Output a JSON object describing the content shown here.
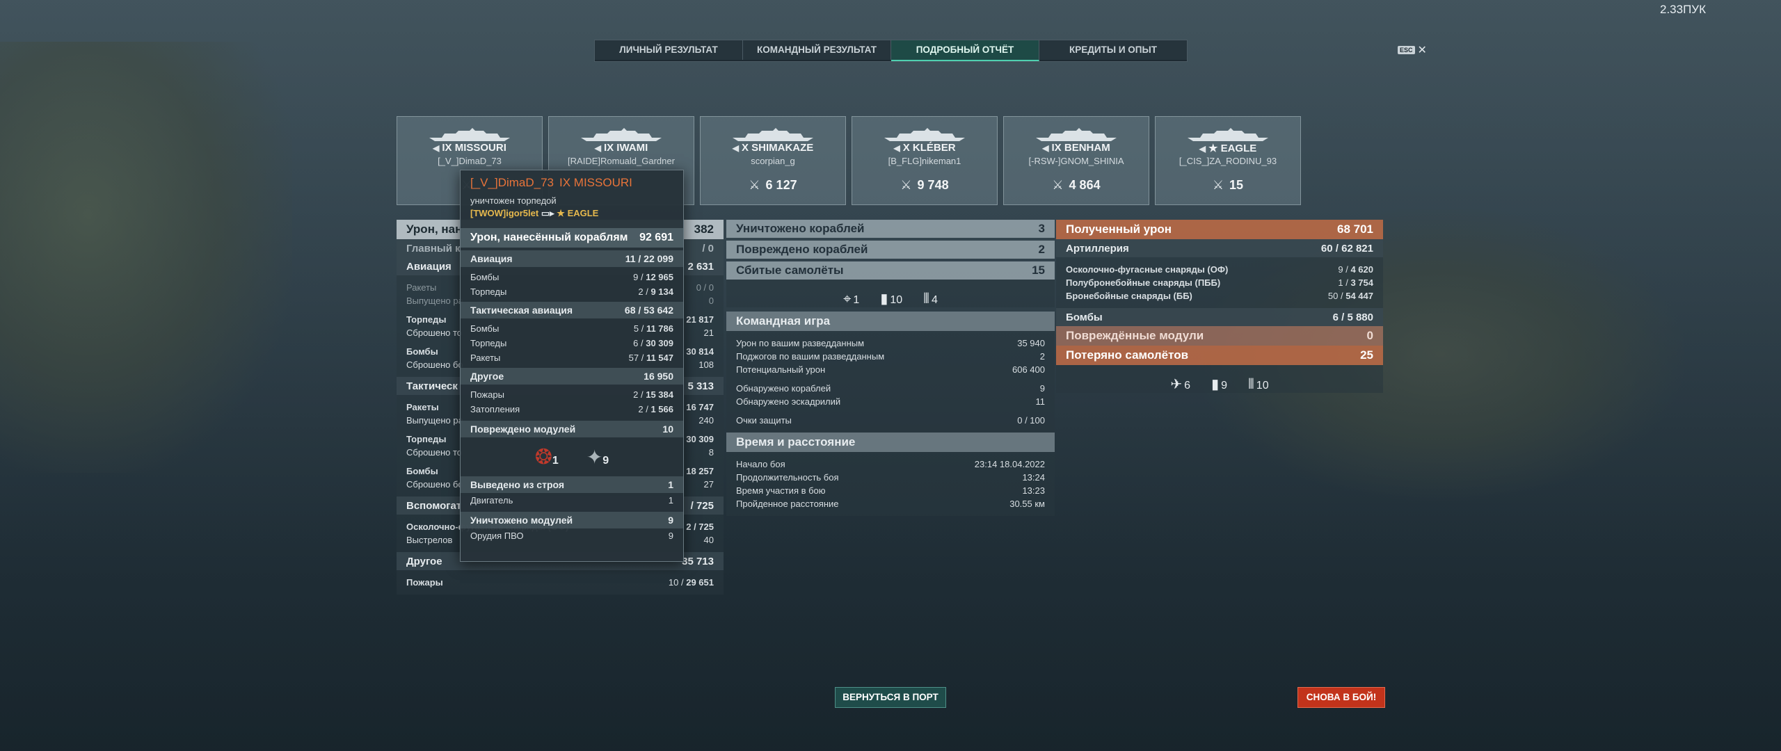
{
  "clock": "2.33ПУК",
  "tabs": [
    "ЛИЧНЫЙ РЕЗУЛЬТАТ",
    "КОМАНДНЫЙ РЕЗУЛЬТАТ",
    "ПОДРОБНЫЙ ОТЧЁТ",
    "КРЕДИТЫ И ОПЫТ"
  ],
  "esc_key": "ESC",
  "esc_close": "✕",
  "cards": [
    {
      "tier": "IX",
      "ship": "MISSOURI",
      "player": "[_V_]DimaD_73",
      "v1": "",
      "v2": ""
    },
    {
      "tier": "IX",
      "ship": "IWAMI",
      "player": "[RAIDE]Romuald_Gardner",
      "v1": "",
      "v2": ""
    },
    {
      "tier": "X",
      "ship": "SHIMAKAZE",
      "player": "scorpian_g",
      "v1": "",
      "v2": "6 127"
    },
    {
      "tier": "X",
      "ship": "KLÉBER",
      "player": "[B_FLG]nikeman1",
      "v1": "",
      "v2": "9 748"
    },
    {
      "tier": "IX",
      "ship": "BENHAM",
      "player": "[-RSW-]GNOM_SHINIA",
      "v1": "",
      "v2": "4 864"
    },
    {
      "tier": "★",
      "ship": "EAGLE",
      "player": "[_CIS_]ZA_RODINU_93",
      "v1": "",
      "v2": "15"
    }
  ],
  "left": {
    "dmg_label": "Урон, нан",
    "dmg_val": "382",
    "main_label": "Главный к",
    "main_val": "/ 0",
    "aviation_label": "Авиация",
    "aviation_val": "2 631",
    "rockets_label": "Ракеты",
    "rockets_val": "0 / 0",
    "rockets_sub": "Выпущено ра",
    "rockets_sub_val": "0",
    "torps_label": "Торпеды",
    "torps_val": "21 817",
    "torps_sub": "Сброшено то",
    "torps_sub_val": "21",
    "bombs_label": "Бомбы",
    "bombs_val": "30 814",
    "bombs_sub": "Сброшено бо",
    "bombs_sub_val": "108",
    "tact_label": "Тактическ",
    "tact_val": "5 313",
    "trockets_label": "Ракеты",
    "trockets_val": "16 747",
    "trockets_sub": "Выпущено ра",
    "trockets_sub_val": "240",
    "ttorps_label": "Торпеды",
    "ttorps_val": "30 309",
    "ttorps_sub": "Сброшено то",
    "ttorps_sub_val": "8",
    "tbombs_label": "Бомбы",
    "tbombs_val": "18 257",
    "tbombs_sub": "Сброшено бо",
    "tbombs_sub_val": "27",
    "sec_label": "Вспомогат",
    "sec_val": "/ 725",
    "he_label": "Осколочно-фугасные снаряды (ОФ)",
    "he_val": "2 / 725",
    "shots_label": "Выстрелов",
    "shots_val": "40",
    "other_label": "Другое",
    "other_val": "35 713",
    "fires_label": "Пожары",
    "fires_a": "10",
    "fires_b": "29 651"
  },
  "mid": {
    "destroyed_label": "Уничтожено кораблей",
    "destroyed_val": "3",
    "damaged_label": "Повреждено кораблей",
    "damaged_val": "2",
    "planes_label": "Сбитые самолёты",
    "planes_val": "15",
    "ic1": "1",
    "ic2": "10",
    "ic3": "4",
    "team_label": "Командная игра",
    "spot_dmg_label": "Урон по вашим разведданным",
    "spot_dmg_val": "35 940",
    "spot_fire_label": "Поджогов по вашим разведданным",
    "spot_fire_val": "2",
    "pot_label": "Потенциальный урон",
    "pot_val": "606 400",
    "det_ships_label": "Обнаружено кораблей",
    "det_ships_val": "9",
    "det_sq_label": "Обнаружено эскадрилий",
    "det_sq_val": "11",
    "def_label": "Очки защиты",
    "def_val": "0 / 100",
    "time_label": "Время и расстояние",
    "start_label": "Начало боя",
    "start_val": "23:14  18.04.2022",
    "dur_label": "Продолжительность боя",
    "dur_val": "13:24",
    "part_label": "Время участия в бою",
    "part_val": "13:23",
    "dist_label": "Пройденное расстояние",
    "dist_val": "30.55 км"
  },
  "right": {
    "recv_label": "Полученный урон",
    "recv_val": "68 701",
    "art_label": "Артиллерия",
    "art_a": "60",
    "art_b": "62 821",
    "he_label": "Осколочно-фугасные снаряды (ОФ)",
    "he_a": "9",
    "he_b": "4 620",
    "sap_label": "Полубронебойные снаряды (ПББ)",
    "sap_a": "1",
    "sap_b": "3 754",
    "ap_label": "Бронебойные снаряды (ББ)",
    "ap_a": "50",
    "ap_b": "54 447",
    "bombs_label": "Бомбы",
    "bombs_a": "6",
    "bombs_b": "5 880",
    "mods_label": "Повреждённые модули",
    "mods_val": "0",
    "lost_label": "Потеряно самолётов",
    "lost_val": "25",
    "ic1": "6",
    "ic2": "9",
    "ic3": "10"
  },
  "tooltip": {
    "player": "[_V_]DimaD_73",
    "ship": "IX MISSOURI",
    "status": "уничтожен торпедой",
    "killer": "[TWOW]igor5let",
    "killer_ship": "EAGLE",
    "dmg_label": "Урон, нанесённый кораблям",
    "dmg_val": "92 691",
    "av_label": "Авиация",
    "av_a": "11",
    "av_b": "22 099",
    "bombs_label": "Бомбы",
    "bombs_a": "9",
    "bombs_b": "12 965",
    "torps_label": "Торпеды",
    "torps_a": "2",
    "torps_b": "9 134",
    "tact_label": "Тактическая авиация",
    "tact_a": "68",
    "tact_b": "53 642",
    "tbombs_label": "Бомбы",
    "tbombs_a": "5",
    "tbombs_b": "11 786",
    "ttorps_label": "Торпеды",
    "ttorps_a": "6",
    "ttorps_b": "30 309",
    "trockets_label": "Ракеты",
    "trockets_a": "57",
    "trockets_b": "11 547",
    "other_label": "Другое",
    "other_val": "16 950",
    "fires_label": "Пожары",
    "fires_a": "2",
    "fires_b": "15 384",
    "flood_label": "Затопления",
    "flood_a": "2",
    "flood_b": "1 566",
    "mods_label": "Повреждено модулей",
    "mods_val": "10",
    "mod_ic1": "1",
    "mod_ic2": "9",
    "inc_label": "Выведено из строя",
    "inc_val": "1",
    "engine_label": "Двигатель",
    "engine_val": "1",
    "destr_label": "Уничтожено модулей",
    "destr_val": "9",
    "aa_label": "Орудия ПВО",
    "aa_val": "9"
  },
  "buttons": {
    "port": "ВЕРНУТЬСЯ В ПОРТ",
    "battle": "СНОВА В БОЙ!"
  }
}
